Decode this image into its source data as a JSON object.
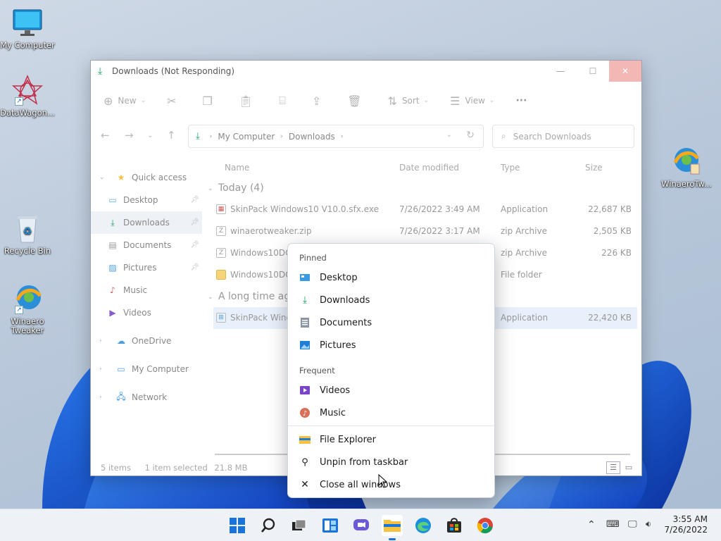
{
  "desktop": {
    "icons": [
      {
        "label": "My Computer"
      },
      {
        "label": "DataWagon..."
      },
      {
        "label": "Recycle Bin"
      },
      {
        "label": "Winaero\nTweaker"
      },
      {
        "label": "WinaeroTw..."
      }
    ]
  },
  "window": {
    "title": "Downloads (Not Responding)",
    "toolbar": {
      "new": "New",
      "sort": "Sort",
      "view": "View",
      "more": "···"
    },
    "address": {
      "crumbs": [
        "My Computer",
        "Downloads"
      ]
    },
    "search": {
      "placeholder": "Search Downloads"
    },
    "nav": {
      "quick_access": "Quick access",
      "items": [
        "Desktop",
        "Downloads",
        "Documents",
        "Pictures",
        "Music",
        "Videos"
      ],
      "onedrive": "OneDrive",
      "my_computer": "My Computer",
      "network": "Network"
    },
    "columns": {
      "name": "Name",
      "date": "Date modified",
      "type": "Type",
      "size": "Size"
    },
    "groups": {
      "today": "Today (4)",
      "long_ago": "A long time ag"
    },
    "files": [
      {
        "name": "SkinPack Windows10 V10.0.sfx.exe",
        "date": "7/26/2022 3:49 AM",
        "type": "Application",
        "size": "22,687 KB"
      },
      {
        "name": "winaerotweaker.zip",
        "date": "7/26/2022 3:17 AM",
        "type": "zip Archive",
        "size": "2,505 KB"
      },
      {
        "name": "Windows10DOS",
        "date": "",
        "type": "zip Archive",
        "size": "226 KB"
      },
      {
        "name": "Windows10DOS",
        "date": "",
        "type": "File folder",
        "size": ""
      },
      {
        "name": "SkinPack Windo",
        "date": "",
        "type": "Application",
        "size": "22,420 KB"
      }
    ],
    "status": {
      "count": "5 items",
      "selected": "1 item selected",
      "size": "21.8 MB"
    }
  },
  "jumplist": {
    "pinned_header": "Pinned",
    "pinned": [
      "Desktop",
      "Downloads",
      "Documents",
      "Pictures"
    ],
    "frequent_header": "Frequent",
    "frequent": [
      "Videos",
      "Music"
    ],
    "tasks": [
      "File Explorer",
      "Unpin from taskbar",
      "Close all windows"
    ]
  },
  "taskbar": {
    "clock_time": "3:55 AM",
    "clock_date": "7/26/2022"
  },
  "colors": {
    "accent": "#1a6fd8",
    "green_download": "#1aa260",
    "close_hover": "#f3b8b6"
  }
}
